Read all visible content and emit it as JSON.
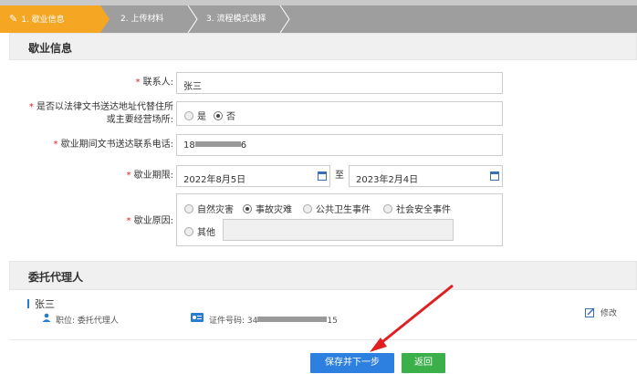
{
  "steps": {
    "step1": "1. 歇业信息",
    "step2": "2. 上传材料",
    "step3": "3. 流程模式选择"
  },
  "section1": {
    "title": "歇业信息"
  },
  "form": {
    "contact_label": "联系人:",
    "contact_value": "张三",
    "address_label_line1": "是否以法律文书送达地址代替住所",
    "address_label_line2": "或主要经营场所:",
    "address_opt_yes": "是",
    "address_opt_no": "否",
    "phone_label": "歇业期间文书送达联系电话:",
    "phone_prefix": "18",
    "phone_suffix": "6",
    "period_label": "歇业期限:",
    "period_start": "2022年8月5日",
    "period_to": "至",
    "period_end": "2023年2月4日",
    "reason_label": "歇业原因:",
    "reason_opts": [
      "自然灾害",
      "事故灾难",
      "公共卫生事件",
      "社会安全事件"
    ],
    "reason_other": "其他",
    "required_mark": "*"
  },
  "section2": {
    "title": "委托代理人"
  },
  "agent": {
    "name": "张三",
    "position": "职位: 委托代理人",
    "id_label": "证件号码: 34",
    "id_suffix": "15",
    "edit": "修改"
  },
  "buttons": {
    "save_next": "保存并下一步",
    "back": "返回"
  },
  "colors": {
    "step_active": "#f5a623",
    "step_inactive": "#9e9e9e",
    "primary": "#2d7fe0",
    "success": "#3aaf4a",
    "required": "#e02020",
    "annotation_arrow": "#e02020"
  }
}
